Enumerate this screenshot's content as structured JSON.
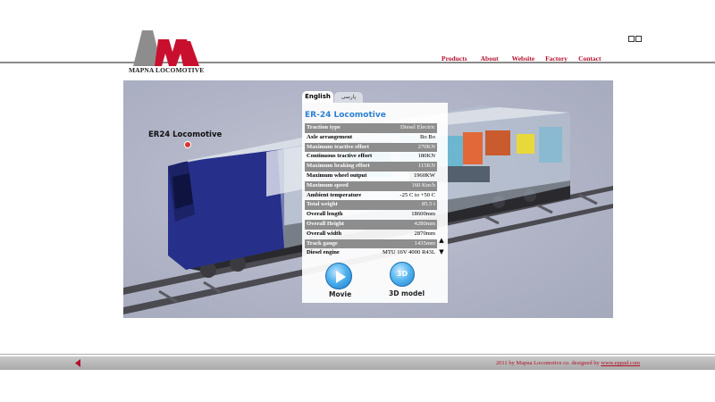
{
  "header": {
    "logo_text": "MAPNA LOCOMOTIVE",
    "nav": [
      "Products",
      "About",
      "Website",
      "Factory",
      "Contact"
    ]
  },
  "viewer": {
    "loco_label": "ER24 Locomotive",
    "tabs": {
      "english": "English",
      "persian": "پارسی"
    },
    "panel_title": "ER-24 Locomotive",
    "specs": [
      {
        "k": "Traction type",
        "v": "Diesel Electric"
      },
      {
        "k": "Axle arrangement",
        "v": "Bo Bo"
      },
      {
        "k": "Maximum tractive effort",
        "v": "270KN"
      },
      {
        "k": "Continuous tractive effort",
        "v": "180KN"
      },
      {
        "k": "Maximum braking effort",
        "v": "115KN"
      },
      {
        "k": "Maximum wheel output",
        "v": "1960KW"
      },
      {
        "k": "Maximum speed",
        "v": "160 Km/h"
      },
      {
        "k": "Ambient temperature",
        "v": "-25 C to +50 C"
      },
      {
        "k": "Total weight",
        "v": "85.5 t"
      },
      {
        "k": "Overall length",
        "v": "18600mm"
      },
      {
        "k": "Overall Height",
        "v": "4280mm"
      },
      {
        "k": "Overall width",
        "v": "2870mm"
      },
      {
        "k": "Track gauge",
        "v": "1435mm"
      },
      {
        "k": "Diesel engine",
        "v": "MTU 16V 4000 R43L"
      }
    ],
    "buttons": {
      "movie": "Movie",
      "model": "3D model",
      "model_icon_text": "3D"
    },
    "icons": {
      "movie": "play-icon",
      "model": "3d-icon"
    }
  },
  "footer": {
    "copyright": "2011 by Mapna Locomotive co. designed by ",
    "link": "www.eppad.com"
  },
  "colors": {
    "nav_red": "#b3102a",
    "title_blue": "#2d7fd0",
    "loco_blue": "#26308a"
  }
}
